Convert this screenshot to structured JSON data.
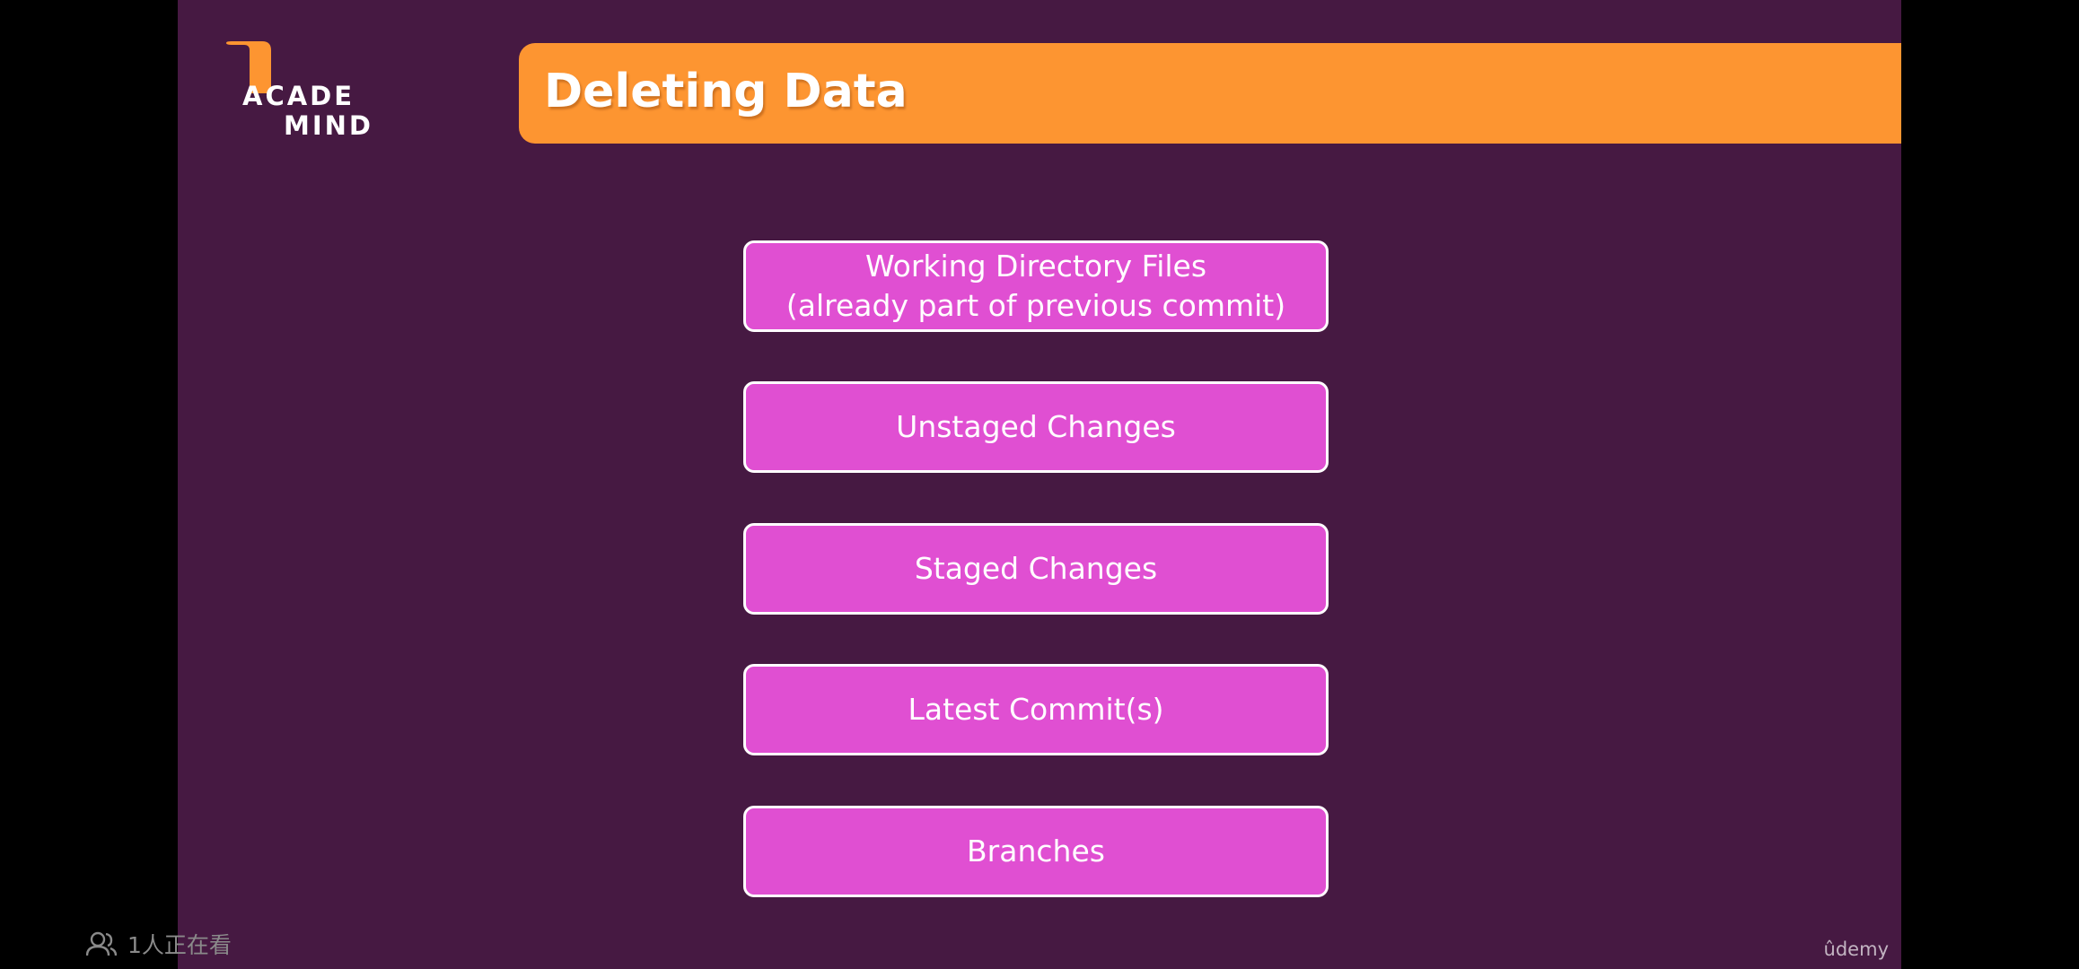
{
  "logo": {
    "line1": "ACADE",
    "line2": "MIND",
    "mark_color": "#fd9531"
  },
  "slide": {
    "title": "Deleting Data",
    "background": "#461942",
    "banner_color": "#fd9531",
    "box_color": "#e04fd2",
    "boxes": [
      {
        "line1": "Working Directory Files",
        "line2": "(already part of previous commit)"
      },
      {
        "line1": "Unstaged Changes"
      },
      {
        "line1": "Staged Changes"
      },
      {
        "line1": "Latest Commit(s)"
      },
      {
        "line1": "Branches"
      }
    ],
    "watermark": "ûdemy"
  },
  "overlay": {
    "viewer_count_text": "1人正在看",
    "viewer_icon": "people-icon"
  }
}
